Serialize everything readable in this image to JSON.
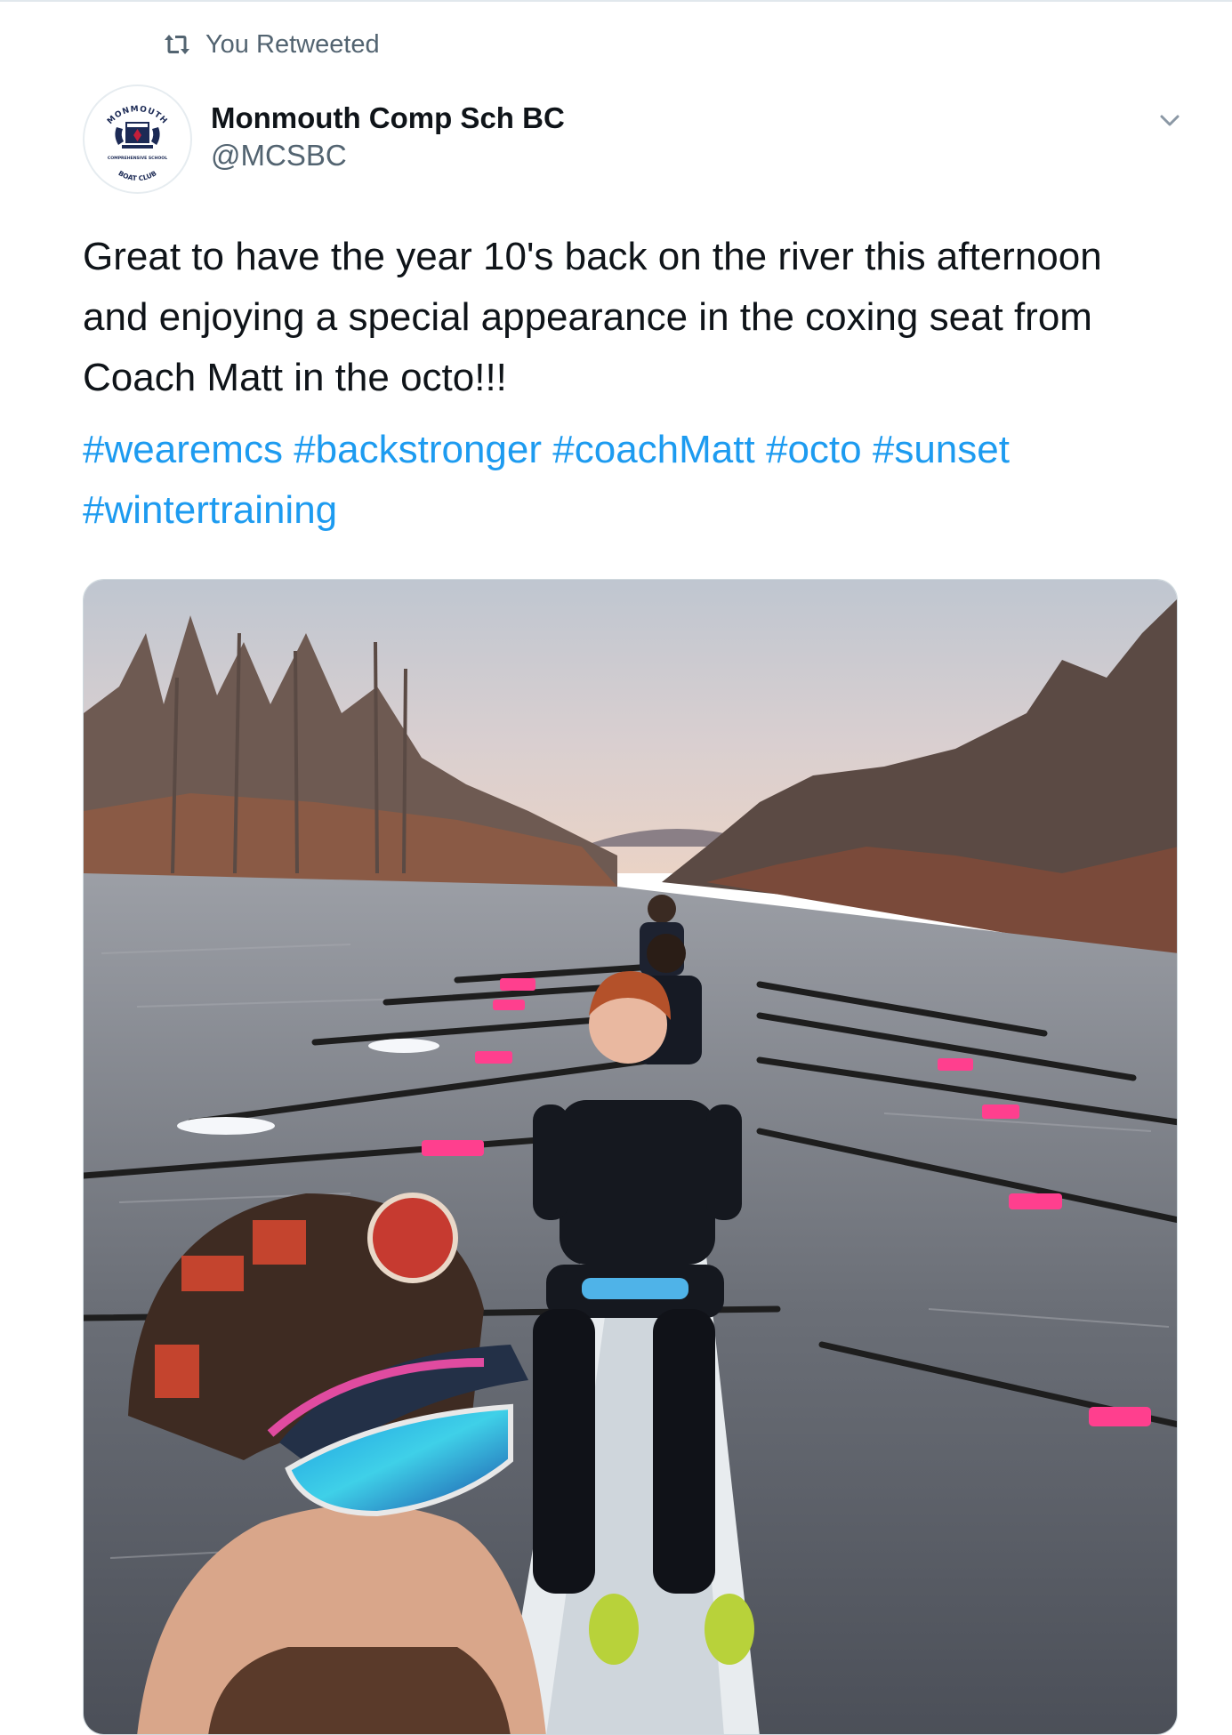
{
  "retweet": {
    "label": "You Retweeted",
    "icon": "retweet-icon"
  },
  "author": {
    "display_name": "Monmouth Comp Sch BC",
    "handle": "@MCSBC",
    "avatar_text_top": "MONMOUTH",
    "avatar_text_middle": "COMPREHENSIVE SCHOOL",
    "avatar_text_bottom": "BOAT CLUB"
  },
  "tweet": {
    "text": "Great to have the year 10's back on the river this afternoon and enjoying a special appearance in the coxing seat from Coach Matt in the octo!!!",
    "hashtags": [
      "#wearemcs",
      "#backstronger",
      "#coachMatt",
      "#octo",
      "#sunset",
      "#wintertraining"
    ]
  },
  "menu": {
    "icon": "chevron-down-icon"
  },
  "colors": {
    "link": "#1d9bf0",
    "secondary_text": "#536471",
    "primary_text": "#0f1419"
  }
}
